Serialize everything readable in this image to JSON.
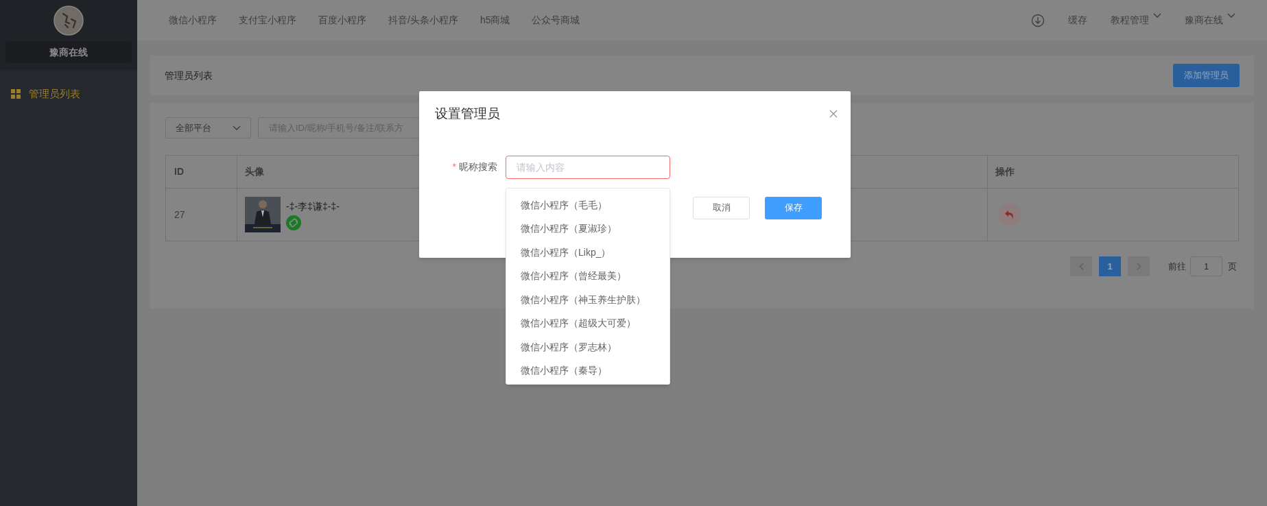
{
  "sidebar": {
    "brand": "豫商在线",
    "menu": [
      {
        "label": "管理员列表",
        "selected": true
      }
    ]
  },
  "top_nav": {
    "tabs": [
      "微信小程序",
      "支付宝小程序",
      "百度小程序",
      "抖音/头条小程序",
      "h5商城",
      "公众号商城"
    ],
    "right_menu": [
      {
        "kind": "download"
      },
      {
        "kind": "text",
        "label": "缓存"
      },
      {
        "kind": "dropdown",
        "label": "教程管理"
      },
      {
        "kind": "dropdown",
        "label": "豫商在线"
      }
    ]
  },
  "page": {
    "title": "管理员列表",
    "add_button": "添加管理员",
    "filter": {
      "platform": "全部平台",
      "search_placeholder": "请输入ID/昵称/手机号/备注/联系方"
    },
    "table": {
      "columns": [
        "ID",
        "头像",
        "操作"
      ],
      "rows": [
        {
          "id": "27",
          "nickname": "-‡-李‡谦‡-‡-"
        }
      ]
    },
    "pagination": {
      "pages": [
        {
          "label": "1",
          "selected": true
        }
      ],
      "goto_label": "前往",
      "goto_value": "1",
      "page_suffix": "页"
    }
  },
  "dialog": {
    "title": "设置管理员",
    "field": {
      "label": "昵称搜索",
      "required_mark": "*",
      "placeholder": "请输入内容"
    },
    "suggestions": [
      "微信小程序（毛毛）",
      "微信小程序（夏淑珍）",
      "微信小程序（Likp_）",
      "微信小程序（曾经最美）",
      "微信小程序（神玉养生护肤）",
      "微信小程序（超级大可爱）",
      "微信小程序（罗志林）",
      "微信小程序（秦导）"
    ],
    "buttons": [
      {
        "label": "取消",
        "kind": "default"
      },
      {
        "label": "保存",
        "kind": "primary"
      }
    ]
  }
}
